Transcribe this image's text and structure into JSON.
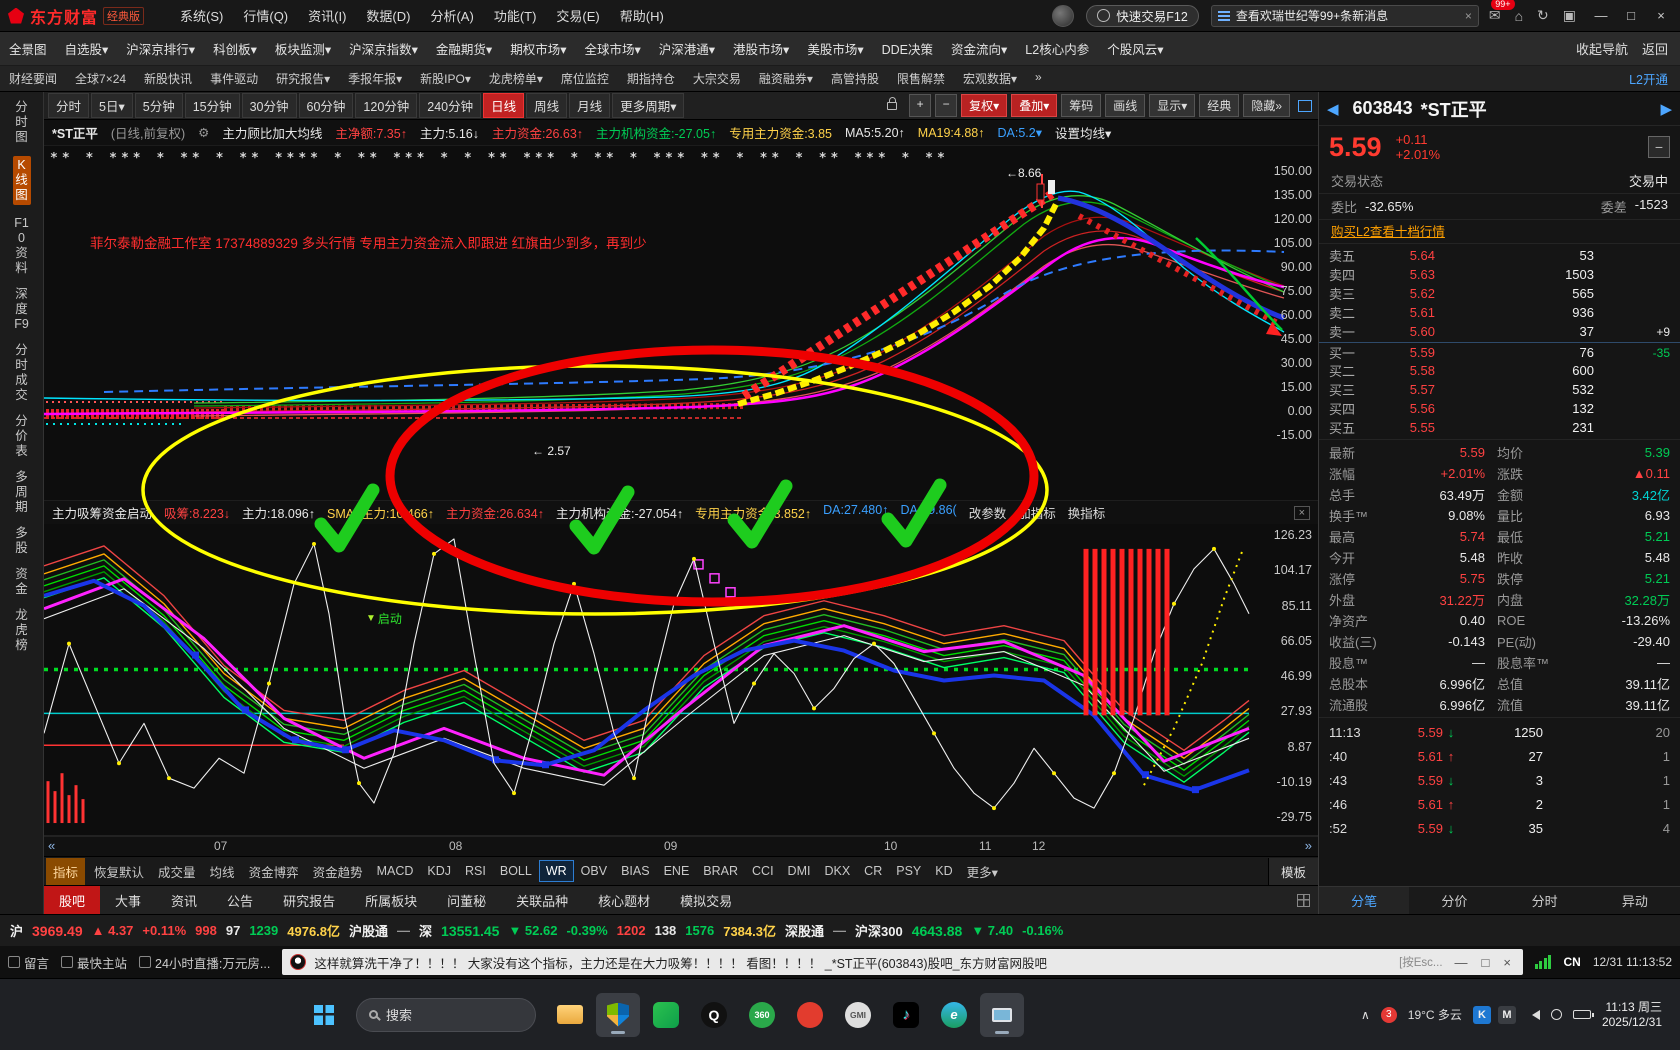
{
  "titlebar": {
    "logo": "东方财富",
    "edition": "经典版",
    "menus": [
      "系统(S)",
      "行情(Q)",
      "资讯(I)",
      "数据(D)",
      "分析(A)",
      "功能(T)",
      "交易(E)",
      "帮助(H)"
    ],
    "quick_trade": "快速交易F12",
    "search_text": "查看欢瑞世纪等99+条新消息",
    "search_close": "×",
    "mail_badge": "99+",
    "icons": [
      {
        "t": "✉"
      },
      {
        "t": "⌂"
      },
      {
        "t": "↻"
      },
      {
        "t": "▣"
      }
    ],
    "controls": [
      {
        "t": "—"
      },
      {
        "t": "□"
      },
      {
        "t": "×"
      }
    ]
  },
  "nav1": {
    "items": [
      {
        "t": "全景图"
      },
      {
        "t": "自选股▾"
      },
      {
        "t": "沪深京排行▾"
      },
      {
        "t": "科创板▾"
      },
      {
        "t": "板块监测▾"
      },
      {
        "t": "沪深京指数▾"
      },
      {
        "t": "金融期货▾"
      },
      {
        "t": "期权市场▾"
      },
      {
        "t": "全球市场▾"
      },
      {
        "t": "沪深港通▾"
      },
      {
        "t": "港股市场▾"
      },
      {
        "t": "美股市场▾"
      },
      {
        "t": "DDE决策"
      },
      {
        "t": "资金流向▾"
      },
      {
        "t": "L2核心内参"
      },
      {
        "t": "个股风云▾"
      }
    ],
    "right": [
      {
        "t": "收起导航"
      },
      {
        "t": "返回"
      }
    ]
  },
  "nav2": {
    "items": [
      {
        "t": "财经要闻"
      },
      {
        "t": "全球7×24"
      },
      {
        "t": "新股快讯"
      },
      {
        "t": "事件驱动"
      },
      {
        "t": "研究报告▾"
      },
      {
        "t": "季报年报▾"
      },
      {
        "t": "新股IPO▾"
      },
      {
        "t": "龙虎榜单▾"
      },
      {
        "t": "席位监控"
      },
      {
        "t": "期指持仓"
      },
      {
        "t": "大宗交易"
      },
      {
        "t": "融资融券▾"
      },
      {
        "t": "高管持股"
      },
      {
        "t": "限售解禁"
      },
      {
        "t": "宏观数据▾"
      },
      {
        "t": "»"
      }
    ],
    "right": "L2开通"
  },
  "sidebar": {
    "items": [
      {
        "t": "分时图"
      },
      {
        "t": "K线图",
        "c": "active"
      },
      {
        "t": "F10资料"
      },
      {
        "t": "深度F9"
      },
      {
        "t": "分时成交"
      },
      {
        "t": "分价表"
      },
      {
        "t": "多周期"
      },
      {
        "t": "多股"
      },
      {
        "t": "资金"
      },
      {
        "t": "龙虎榜"
      }
    ]
  },
  "toolbar": {
    "periods": [
      {
        "t": "分时"
      },
      {
        "t": "5日▾"
      },
      {
        "t": "5分钟"
      },
      {
        "t": "15分钟"
      },
      {
        "t": "30分钟"
      },
      {
        "t": "60分钟"
      },
      {
        "t": "120分钟"
      },
      {
        "t": "240分钟"
      },
      {
        "t": "日线",
        "c": "sel"
      },
      {
        "t": "周线"
      },
      {
        "t": "月线"
      },
      {
        "t": "更多周期▾"
      }
    ],
    "tools": [
      {
        "t": "+",
        "c": "sq"
      },
      {
        "t": "−",
        "c": "sq"
      },
      {
        "t": "复权▾",
        "c": "red"
      },
      {
        "t": "叠加▾",
        "c": "red"
      },
      {
        "t": "筹码"
      },
      {
        "t": "画线"
      },
      {
        "t": "显示▾"
      },
      {
        "t": "经典"
      },
      {
        "t": "隐藏»"
      }
    ]
  },
  "main_info": {
    "parts": [
      {
        "t": "*ST正平",
        "c": "w bold"
      },
      {
        "t": "(日线,前复权)",
        "c": "g"
      },
      {
        "t": "⚙",
        "c": "g"
      },
      {
        "t": "主力顾比加大均线",
        "c": "w"
      },
      {
        "t": "主净额:7.35↑",
        "c": "r"
      },
      {
        "t": "主力:5.16↓",
        "c": "w"
      },
      {
        "t": "主力资金:26.63↑",
        "c": "r"
      },
      {
        "t": "主力机构资金:-27.05↑",
        "c": "gr"
      },
      {
        "t": "专用主力资金:3.85",
        "c": "y"
      },
      {
        "t": "MA5:5.20↑",
        "c": "w"
      },
      {
        "t": "MA19:4.88↑",
        "c": "y"
      },
      {
        "t": "DA:5.2▾",
        "c": "b"
      },
      {
        "t": "设置均线▾",
        "c": "w"
      }
    ]
  },
  "sub_info": {
    "parts": [
      {
        "t": "主力吸筹资金启动",
        "c": "w"
      },
      {
        "t": "吸筹:8.223↓",
        "c": "r"
      },
      {
        "t": "主力:18.096↑",
        "c": "w"
      },
      {
        "t": "SMA3主力:10.466↑",
        "c": "y"
      },
      {
        "t": "主力资金:26.634↑",
        "c": "r"
      },
      {
        "t": "主力机构资金:-27.054↑",
        "c": "w"
      },
      {
        "t": "专用主力资金:3.852↑",
        "c": "y"
      },
      {
        "t": "DA:27.480↑",
        "c": "b"
      },
      {
        "t": "DA:19.86(",
        "c": "b"
      },
      {
        "t": "改参数",
        "c": "link"
      },
      {
        "t": "加指标",
        "c": "link"
      },
      {
        "t": "换指标",
        "c": "link"
      }
    ],
    "close": "×"
  },
  "chart": {
    "y_main": [
      "150.00",
      "135.00",
      "120.00",
      "105.00",
      "90.00",
      "75.00",
      "60.00",
      "45.00",
      "30.00",
      "15.00",
      "0.00",
      "-15.00"
    ],
    "y_sub": [
      "126.23",
      "104.17",
      "85.11",
      "66.05",
      "46.99",
      "27.93",
      "8.87",
      "-10.19",
      "-29.75"
    ],
    "x_months": [
      "07",
      "08",
      "09",
      "10",
      "11",
      "12"
    ],
    "note": "菲尔泰勒金融工作室 17374889329 多头行情  专用主力资金流入即跟进 红旗由少到多，再到少",
    "peak_label": "←8.66",
    "mid_label": "← 2.57",
    "signal_tri": "▼",
    "signal_label": "启动",
    "markers": "**  *  ***  *  **  *  **  ****  *  **  ***  *  *  **  ***  *  **  *  ***  **  *  **  *  **  ***  *  **",
    "scroll_left": "«",
    "scroll_right": "»"
  },
  "indicator_tabs": {
    "items": [
      {
        "t": "指标",
        "c": "lead"
      },
      {
        "t": "恢复默认"
      },
      {
        "t": "成交量"
      },
      {
        "t": "均线"
      },
      {
        "t": "资金博弈"
      },
      {
        "t": "资金趋势"
      },
      {
        "t": "MACD"
      },
      {
        "t": "KDJ"
      },
      {
        "t": "RSI"
      },
      {
        "t": "BOLL"
      },
      {
        "t": "WR",
        "c": "sel"
      },
      {
        "t": "OBV"
      },
      {
        "t": "BIAS"
      },
      {
        "t": "ENE"
      },
      {
        "t": "BRAR"
      },
      {
        "t": "CCI"
      },
      {
        "t": "DMI"
      },
      {
        "t": "DKX"
      },
      {
        "t": "CR"
      },
      {
        "t": "PSY"
      },
      {
        "t": "KD"
      },
      {
        "t": "更多▾"
      }
    ],
    "right": "模板"
  },
  "bottom_tabs": {
    "items": [
      {
        "t": "股吧",
        "c": "sel"
      },
      {
        "t": "大事"
      },
      {
        "t": "资讯"
      },
      {
        "t": "公告"
      },
      {
        "t": "研究报告"
      },
      {
        "t": "所属板块"
      },
      {
        "t": "问董秘"
      },
      {
        "t": "关联品种"
      },
      {
        "t": "核心题材"
      },
      {
        "t": "模拟交易"
      }
    ]
  },
  "quote": {
    "prev": "◀",
    "next": "▶",
    "code": "603843",
    "name": "*ST正平",
    "price": "5.59",
    "change": "+0.11",
    "pct": "+2.01%",
    "collapse": "−",
    "status_label": "交易状态",
    "status": "交易中",
    "weibi_label": "委比",
    "weibi": "-32.65%",
    "weicha_label": "委差",
    "weicha": "-1523",
    "l2": "购买L2查看十档行情",
    "orders": [
      {
        "n": "卖五",
        "p": "5.64",
        "q": "53"
      },
      {
        "n": "卖四",
        "p": "5.63",
        "q": "1503"
      },
      {
        "n": "卖三",
        "p": "5.62",
        "q": "565"
      },
      {
        "n": "卖二",
        "p": "5.61",
        "q": "936"
      },
      {
        "n": "卖一",
        "p": "5.60",
        "q": "37",
        "x": "+9",
        "xc": "w"
      },
      {
        "n": "买一",
        "p": "5.59",
        "q": "76",
        "x": "-35",
        "xc": "gr",
        "c": "sep"
      },
      {
        "n": "买二",
        "p": "5.58",
        "q": "600"
      },
      {
        "n": "买三",
        "p": "5.57",
        "q": "532"
      },
      {
        "n": "买四",
        "p": "5.56",
        "q": "132"
      },
      {
        "n": "买五",
        "p": "5.55",
        "q": "231"
      }
    ],
    "stats": [
      {
        "l1": "最新",
        "v1": "5.59",
        "c1": "r",
        "l2": "均价",
        "v2": "5.39",
        "c2": "gr"
      },
      {
        "l1": "涨幅",
        "v1": "+2.01%",
        "c1": "r",
        "l2": "涨跌",
        "v2": "▲0.11",
        "c2": "r"
      },
      {
        "l1": "总手",
        "v1": "63.49万",
        "c1": "w",
        "l2": "金额",
        "v2": "3.42亿",
        "c2": "c"
      },
      {
        "l1": "换手™",
        "v1": "9.08%",
        "c1": "w",
        "l2": "量比",
        "v2": "6.93",
        "c2": "w"
      },
      {
        "l1": "最高",
        "v1": "5.74",
        "c1": "r",
        "l2": "最低",
        "v2": "5.21",
        "c2": "gr"
      },
      {
        "l1": "今开",
        "v1": "5.48",
        "c1": "w",
        "l2": "昨收",
        "v2": "5.48",
        "c2": "w"
      },
      {
        "l1": "涨停",
        "v1": "5.75",
        "c1": "r",
        "l2": "跌停",
        "v2": "5.21",
        "c2": "gr"
      },
      {
        "l1": "外盘",
        "v1": "31.22万",
        "c1": "r",
        "l2": "内盘",
        "v2": "32.28万",
        "c2": "gr"
      },
      {
        "l1": "净资产",
        "v1": "0.40",
        "c1": "w",
        "l2": "ROE",
        "v2": "-13.26%",
        "c2": "w"
      },
      {
        "l1": "收益(三)",
        "v1": "-0.143",
        "c1": "w",
        "l2": "PE(动)",
        "v2": "-29.40",
        "c2": "w"
      },
      {
        "l1": "股息™",
        "v1": "—",
        "c1": "w",
        "l2": "股息率™",
        "v2": "—",
        "c2": "w"
      },
      {
        "l1": "总股本",
        "v1": "6.996亿",
        "c1": "w",
        "l2": "总值",
        "v2": "39.11亿",
        "c2": "w"
      },
      {
        "l1": "流通股",
        "v1": "6.996亿",
        "c1": "w",
        "l2": "流值",
        "v2": "39.11亿",
        "c2": "w"
      }
    ],
    "ticks": [
      {
        "t": "11:13",
        "p": "5.59",
        "a": "↓",
        "ac": "gr",
        "v": "1250",
        "n": "20"
      },
      {
        "t": ":40",
        "p": "5.61",
        "a": "↑",
        "ac": "r",
        "v": "27",
        "n": "1"
      },
      {
        "t": ":43",
        "p": "5.59",
        "a": "↓",
        "ac": "gr",
        "v": "3",
        "n": "1"
      },
      {
        "t": ":46",
        "p": "5.61",
        "a": "↑",
        "ac": "r",
        "v": "2",
        "n": "1"
      },
      {
        "t": ":52",
        "p": "5.59",
        "a": "↓",
        "ac": "gr",
        "v": "35",
        "n": "4"
      }
    ],
    "tabs": [
      {
        "t": "分笔",
        "c": "sel"
      },
      {
        "t": "分价"
      },
      {
        "t": "分时"
      },
      {
        "t": "异动"
      }
    ]
  },
  "index_bar": {
    "parts": [
      {
        "t": "沪",
        "c": "lbl"
      },
      {
        "t": "3969.49",
        "c": "r big"
      },
      {
        "t": "▲ 4.37",
        "c": "r"
      },
      {
        "t": "+0.11%",
        "c": "r"
      },
      {
        "t": "998",
        "c": "r"
      },
      {
        "t": "97",
        "c": "w"
      },
      {
        "t": "1239",
        "c": "gr"
      },
      {
        "t": "4976.8亿",
        "c": "y"
      },
      {
        "t": "沪股通",
        "c": "lbl"
      },
      {
        "t": "—",
        "c": "g"
      },
      {
        "t": "深",
        "c": "lbl"
      },
      {
        "t": "13551.45",
        "c": "gr big"
      },
      {
        "t": "▼ 52.62",
        "c": "gr"
      },
      {
        "t": "-0.39%",
        "c": "gr"
      },
      {
        "t": "1202",
        "c": "r"
      },
      {
        "t": "138",
        "c": "w"
      },
      {
        "t": "1576",
        "c": "gr"
      },
      {
        "t": "7384.3亿",
        "c": "y"
      },
      {
        "t": "深股通",
        "c": "lbl"
      },
      {
        "t": "—",
        "c": "g"
      },
      {
        "t": "沪深300",
        "c": "lbl"
      },
      {
        "t": "4643.88",
        "c": "gr big"
      },
      {
        "t": "▼ 7.40",
        "c": "gr"
      },
      {
        "t": "-0.16%",
        "c": "gr"
      }
    ]
  },
  "statusbar": {
    "left": [
      {
        "t": "留言"
      },
      {
        "t": "最快主站"
      },
      {
        "t": "24小时直播:万元房..."
      }
    ],
    "news": "这样就算洗干净了！！！！  大家没有这个指标，主力还是在大力吸筹！！！！  看图！！！！  _*ST正平(603843)股吧_东方财富网股吧",
    "esc": "[按Esc...",
    "controls": [
      {
        "t": "—"
      },
      {
        "t": "□"
      },
      {
        "t": "×"
      }
    ],
    "cn": "CN",
    "time": "12/31 11:13:52"
  },
  "taskbar": {
    "search": "搜索",
    "icons": [
      {
        "c": "ic-folder"
      },
      {
        "c": "ic-shield on"
      },
      {
        "c": "ic-leaf"
      },
      {
        "t": "Q",
        "c": "ic-qq"
      },
      {
        "t": "360",
        "c": "ic-360"
      },
      {
        "c": "ic-red"
      },
      {
        "t": "GMI",
        "c": "ic-gmi"
      },
      {
        "t": "♪",
        "c": "ic-dy"
      },
      {
        "t": "e",
        "c": "ic-e"
      },
      {
        "c": "ic-snip on"
      }
    ],
    "chev": "∧",
    "badge": "3",
    "weather": "19°C 多云",
    "tiles": [
      {
        "t": "K",
        "c": "tile-k"
      },
      {
        "t": "M"
      }
    ],
    "clock1": "11:13 周三",
    "clock2": "2025/12/31"
  }
}
